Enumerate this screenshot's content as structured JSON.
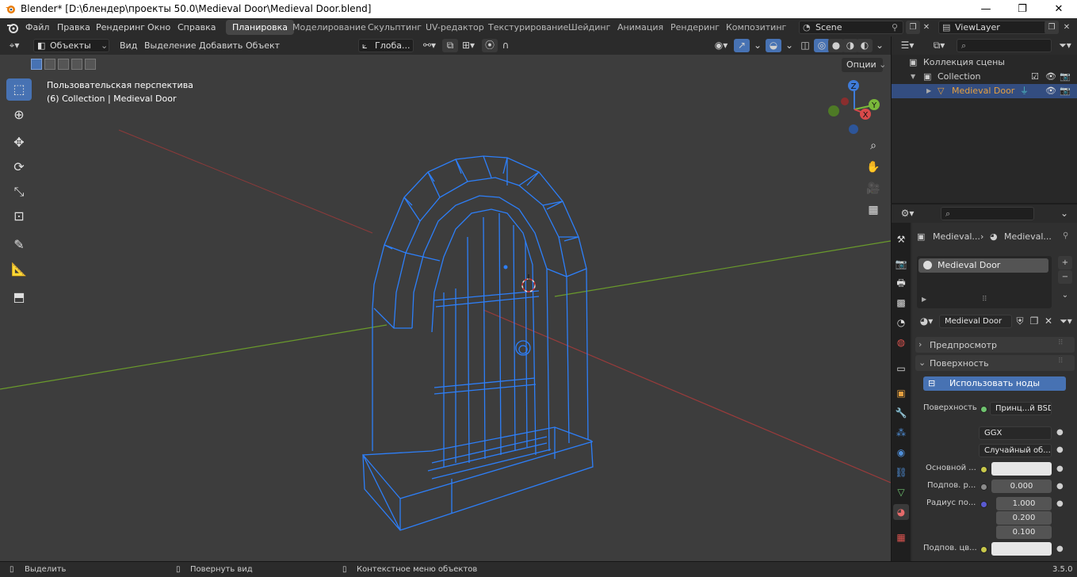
{
  "window": {
    "title": "Blender* [D:\\блендер\\проекты 50.0\\Medieval Door\\Medieval Door.blend]",
    "min": "—",
    "max": "❐",
    "close": "✕"
  },
  "menu": {
    "file": "Файл",
    "edit": "Правка",
    "render": "Рендеринг",
    "window": "Окно",
    "help": "Справка"
  },
  "workspaces": [
    "Планировка",
    "Моделирование",
    "Скульптинг",
    "UV-редактор",
    "Текстурирование",
    "Шейдинг",
    "Анимация",
    "Рендеринг",
    "Композитинг"
  ],
  "scene": {
    "label": "Scene"
  },
  "viewlayer": {
    "label": "ViewLayer"
  },
  "vp_header": {
    "mode": "Объекты",
    "view": "Вид",
    "select": "Выделение",
    "add": "Добавить",
    "object": "Объект",
    "orientation": "Глоба...",
    "options": "Опции"
  },
  "viewport": {
    "perspective": "Пользовательская перспектива",
    "collection_info": "(6) Collection | Medieval Door",
    "gizmo": {
      "z": "Z",
      "y": "Y",
      "x": "X"
    }
  },
  "outliner": {
    "scene_collection": "Коллекция сцены",
    "collection": "Collection",
    "object": "Medieval Door"
  },
  "properties": {
    "breadcrumb_obj": "Medieval...",
    "breadcrumb_mat": "Medieval...",
    "slot_name": "Medieval Door",
    "material_name": "Medieval Door",
    "preview": "Предпросмотр",
    "surface_section": "Поверхность",
    "use_nodes": "Использовать ноды",
    "surface_label": "Поверхность",
    "surface_value": "Принц...й BSDF",
    "distribution": "GGX",
    "subsurface_method": "Случайный об...",
    "base_color_label": "Основной ...",
    "subsurface_label": "Подпов. р...",
    "subsurface_value": "0.000",
    "radius_label": "Радиус по...",
    "radius_x": "1.000",
    "radius_y": "0.200",
    "radius_z": "0.100",
    "subsurface_color_label": "Подпов. цв..."
  },
  "status": {
    "select": "Выделить",
    "rotate": "Повернуть вид",
    "context": "Контекстное меню объектов",
    "version": "3.5.0"
  },
  "colors": {
    "accent": "#4772b3",
    "selection": "#2d7ff9",
    "object_orange": "#e6a040",
    "grid_red": "#9b3b3b",
    "grid_green": "#6a9a2c"
  }
}
